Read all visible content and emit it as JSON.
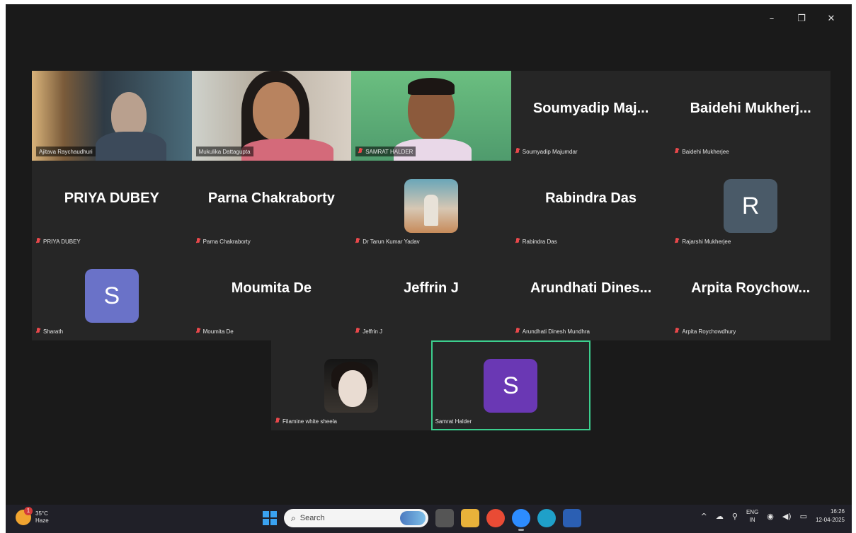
{
  "window": {
    "controls": {
      "minimize": "–",
      "restore": "❐",
      "close": "✕"
    }
  },
  "participants_row1": [
    {
      "name": "Ajitava Raychaudhuri",
      "type": "video"
    },
    {
      "name": "Mukulika Dattagupta",
      "type": "video"
    },
    {
      "name": "SAMRAT HALDER",
      "type": "video"
    },
    {
      "display": "Soumyadip  Maj...",
      "name": "Soumyadip Majumdar",
      "type": "name"
    },
    {
      "display": "Baidehi  Mukherj...",
      "name": "Baidehi Mukherjee",
      "type": "name"
    }
  ],
  "participants_row2": [
    {
      "display": "PRIYA DUBEY",
      "name": "PRIYA DUBEY",
      "type": "name"
    },
    {
      "display": "Parna Chakraborty",
      "name": "Parna Chakraborty",
      "type": "name"
    },
    {
      "name": "Dr Tarun Kumar Yadav",
      "type": "photo"
    },
    {
      "display": "Rabindra Das",
      "name": "Rabindra Das",
      "type": "name"
    },
    {
      "initial": "R",
      "name": "Rajarshi Mukherjee",
      "type": "initial",
      "color": "#4a5a68"
    }
  ],
  "participants_row3": [
    {
      "initial": "S",
      "name": "Sharath",
      "type": "initial",
      "color": "#6a72c8"
    },
    {
      "display": "Moumita De",
      "name": "Moumita De",
      "type": "name"
    },
    {
      "display": "Jeffrin J",
      "name": "Jeffrin J",
      "type": "name"
    },
    {
      "display": "Arundhati  Dines...",
      "name": "Arundhati Dinesh Mundhra",
      "type": "name"
    },
    {
      "display": "Arpita  Roychow...",
      "name": "Arpita Roychowdhury",
      "type": "name"
    }
  ],
  "participants_row4": [
    {
      "name": "Filamine white sheela",
      "type": "photo"
    },
    {
      "initial": "S",
      "name": "Samrat Halder",
      "type": "initial",
      "color": "#6a38b4",
      "active_speaker": true
    }
  ],
  "taskbar": {
    "weather_temp": "35°C",
    "weather_desc": "Haze",
    "weather_badge": "1",
    "search_glyph": "⌕",
    "search_label": "Search",
    "tray_chevron": "^",
    "tray_lang_1": "ENG",
    "tray_lang_2": "IN",
    "tray_wifi": "◉",
    "tray_volume": "◀)",
    "tray_battery": "▭",
    "time": "16:26",
    "date": "12-04-2025"
  }
}
